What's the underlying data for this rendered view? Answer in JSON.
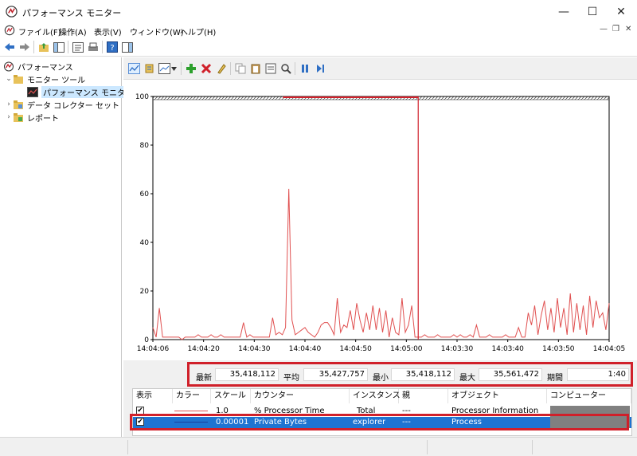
{
  "window": {
    "title": "パフォーマンス モニター",
    "minimize_glyph": "—",
    "maximize_glyph": "☐",
    "close_glyph": "✕"
  },
  "menu": {
    "items": [
      "ファイル(F)",
      "操作(A)",
      "表示(V)",
      "ウィンドウ(W)",
      "ヘルプ(H)"
    ],
    "mdi_minimize": "—",
    "mdi_restore": "❐",
    "mdi_close": "✕"
  },
  "tree": {
    "root": "パフォーマンス",
    "monitoring_tools": "モニター ツール",
    "performance_monitor": "パフォーマンス モニター",
    "data_collector_sets": "データ コレクター セット",
    "reports": "レポート",
    "expanded_glyph": "⌄",
    "collapsed_glyph": "›"
  },
  "chart_data": {
    "type": "line",
    "ylim": [
      0,
      100
    ],
    "y_ticks": [
      "100",
      "80",
      "60",
      "40",
      "20",
      "0"
    ],
    "x_tick_labels": [
      "14:04:06",
      "14:04:20",
      "14:04:30",
      "14:04:40",
      "14:04:50",
      "14:05:00",
      "14:03:30",
      "14:03:40",
      "14:03:50",
      "14:04:05"
    ],
    "grid": false,
    "series": [
      {
        "name": "% Processor Time",
        "color": "#e05050",
        "values": [
          5,
          1,
          13,
          1,
          1,
          1,
          1,
          1,
          1,
          0,
          1,
          1,
          1,
          1,
          2,
          1,
          1,
          1,
          2,
          1,
          1,
          2,
          1,
          1,
          1,
          1,
          1,
          1,
          7,
          1,
          2,
          1,
          1,
          1,
          1,
          1,
          1,
          9,
          2,
          3,
          2,
          5,
          62,
          8,
          2,
          3,
          4,
          5,
          3,
          2,
          1,
          3,
          6,
          7,
          7,
          5,
          2,
          17,
          3,
          6,
          5,
          12,
          4,
          15,
          8,
          3,
          11,
          4,
          14,
          4,
          13,
          3,
          12,
          1,
          9,
          3,
          2,
          17,
          3,
          6,
          14,
          1,
          1,
          1,
          2,
          1,
          1,
          1,
          2,
          1,
          1,
          1,
          1,
          2,
          1,
          2,
          1,
          1,
          2,
          1,
          6,
          1,
          1,
          1,
          2,
          1,
          1,
          1,
          1,
          2,
          1,
          1,
          1,
          5,
          1,
          1,
          11,
          6,
          14,
          2,
          10,
          16,
          4,
          13,
          3,
          17,
          5,
          13,
          2,
          19,
          3,
          15,
          4,
          14,
          2,
          18,
          5,
          16,
          9,
          11,
          4,
          15
        ]
      }
    ],
    "current_marker_index": 82
  },
  "stats": {
    "latest_label": "最新",
    "latest_value": "35,418,112",
    "average_label": "平均",
    "average_value": "35,427,757",
    "minimum_label": "最小",
    "minimum_value": "35,418,112",
    "maximum_label": "最大",
    "maximum_value": "35,561,472",
    "duration_label": "期間",
    "duration_value": "1:40"
  },
  "counter_table": {
    "headers": [
      "表示",
      "カラー",
      "スケール",
      "カウンター",
      "インスタンス",
      "親",
      "オブジェクト",
      "コンピューター"
    ],
    "rows": [
      {
        "checked": "✔",
        "color": "#e05050",
        "scale": "1.0",
        "counter": "% Processor Time",
        "instance": "_Total",
        "parent": "---",
        "object": "Processor Information",
        "computer": ""
      },
      {
        "checked": "✔",
        "color": "#1a3f9e",
        "scale": "0.00001",
        "counter": "Private Bytes",
        "instance": "explorer",
        "parent": "---",
        "object": "Process",
        "computer": ""
      }
    ]
  },
  "colors": {
    "highlight_red": "#d0202a",
    "selection_blue": "#1e74d2",
    "computer_cell_gray": "#808080"
  }
}
